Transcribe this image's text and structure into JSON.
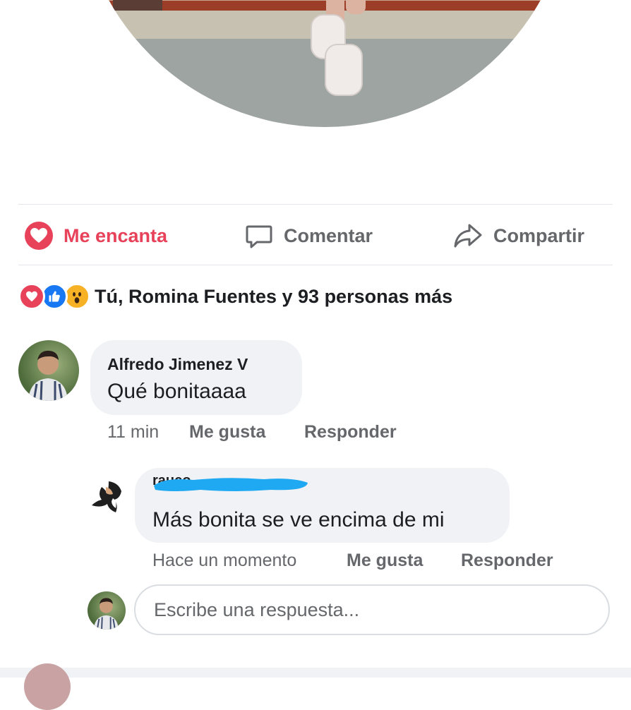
{
  "post": {
    "photo_alt": "profile photo",
    "actions": {
      "love_label": "Me encanta",
      "comment_label": "Comentar",
      "share_label": "Compartir",
      "love_color": "#e8415a",
      "muted_color": "#65676b"
    },
    "reactions": {
      "icons": [
        "heart-icon",
        "like-icon",
        "wow-icon"
      ],
      "summary": "Tú, Romina Fuentes y 93 personas más"
    }
  },
  "comments": [
    {
      "author": "Alfredo Jimenez V",
      "text": "Qué bonitaaaa",
      "time": "11 min",
      "like_label": "Me gusta",
      "reply_label": "Responder"
    }
  ],
  "reply": {
    "author_visible_fragment": "rauco",
    "author_redaction_color": "#1fa9f2",
    "text": "Más bonita se ve encima de mi",
    "time": "Hace un momento",
    "like_label": "Me gusta",
    "reply_label": "Responder"
  },
  "reply_box": {
    "placeholder": "Escribe una respuesta..."
  }
}
